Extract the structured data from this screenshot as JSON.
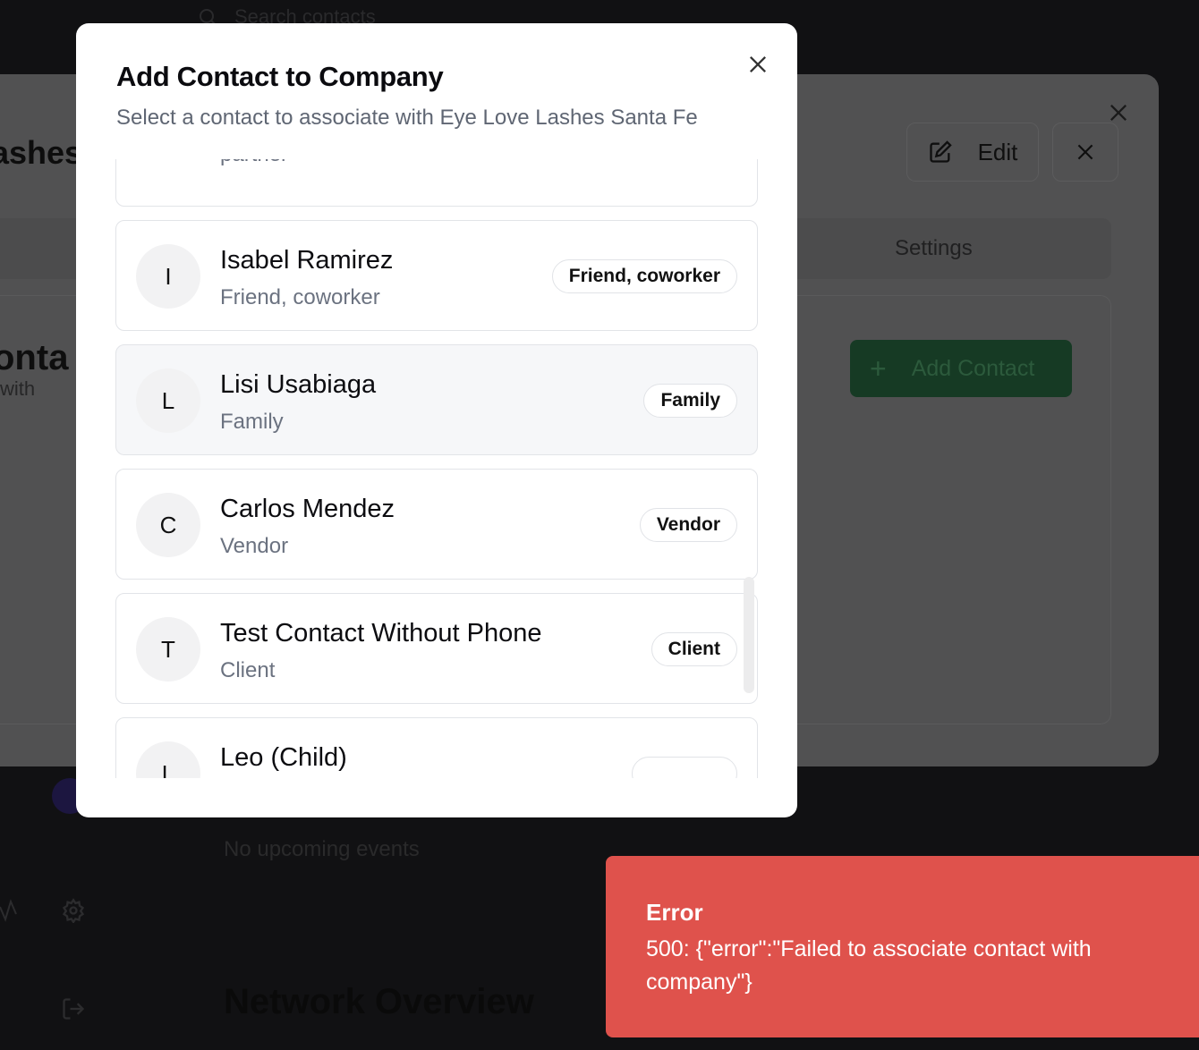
{
  "background": {
    "search_placeholder": "Search contacts",
    "company_name_partial": "ashes",
    "edit_label": "Edit",
    "settings_tab": "Settings",
    "contacts_title_partial": "onta",
    "contacts_sub_partial": "with",
    "add_contact_label": "Add Contact",
    "no_events": "No upcoming events",
    "network_title": "Network Overview"
  },
  "modal": {
    "title": "Add Contact to Company",
    "subtitle": "Select a contact to associate with Eye Love Lashes Santa Fe",
    "contacts": [
      {
        "initial": "",
        "name": "",
        "relationship": "Friend, coworker, partner",
        "badge": ""
      },
      {
        "initial": "I",
        "name": "Isabel Ramirez",
        "relationship": "Friend, coworker",
        "badge": "Friend, coworker"
      },
      {
        "initial": "L",
        "name": "Lisi Usabiaga",
        "relationship": "Family",
        "badge": "Family"
      },
      {
        "initial": "C",
        "name": "Carlos Mendez",
        "relationship": "Vendor",
        "badge": "Vendor"
      },
      {
        "initial": "T",
        "name": "Test Contact Without Phone",
        "relationship": "Client",
        "badge": "Client"
      },
      {
        "initial": "L",
        "name": "Leo (Child)",
        "relationship": "",
        "badge": ""
      }
    ]
  },
  "toast": {
    "title": "Error",
    "message": "500: {\"error\":\"Failed to associate contact with company\"}"
  },
  "colors": {
    "toast_bg": "#df524c",
    "add_contact_bg": "#163a24"
  }
}
